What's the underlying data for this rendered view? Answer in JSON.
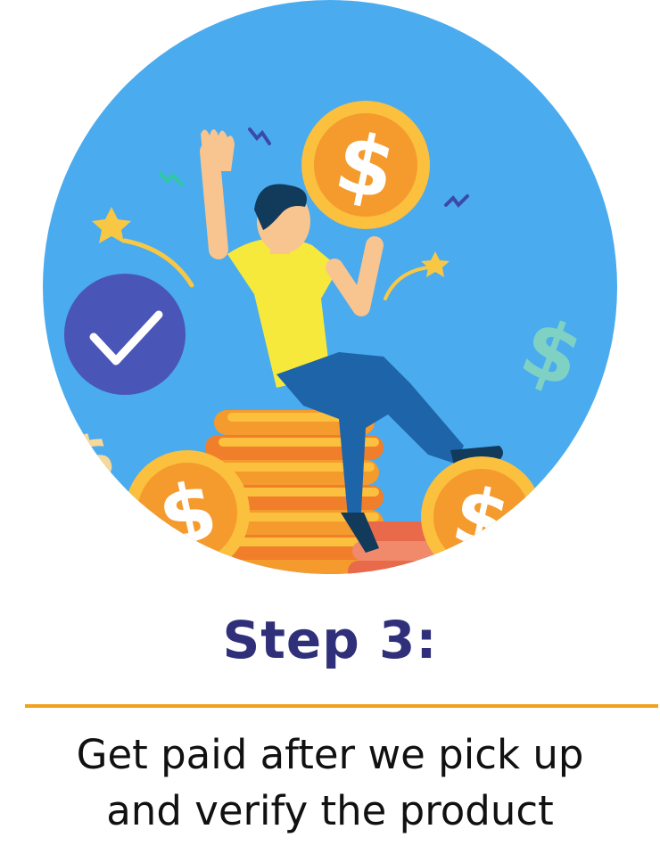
{
  "illustration": {
    "coin_symbol": "$",
    "check_symbol": "✓",
    "colors": {
      "background_circle": "#4aabef",
      "coin": "#f59a2c",
      "coin_rim": "#fbc03d",
      "shirt": "#f7e93b",
      "pants": "#1e64a8",
      "check_badge": "#4a55b8",
      "money_sign_teal": "#7fd1c4"
    }
  },
  "step": {
    "title": "Step 3:",
    "description_line1": "Get paid after we pick up",
    "description_line2": "and verify the product"
  },
  "colors": {
    "title": "#30307a",
    "divider": "#f2a11c",
    "text": "#111111"
  }
}
